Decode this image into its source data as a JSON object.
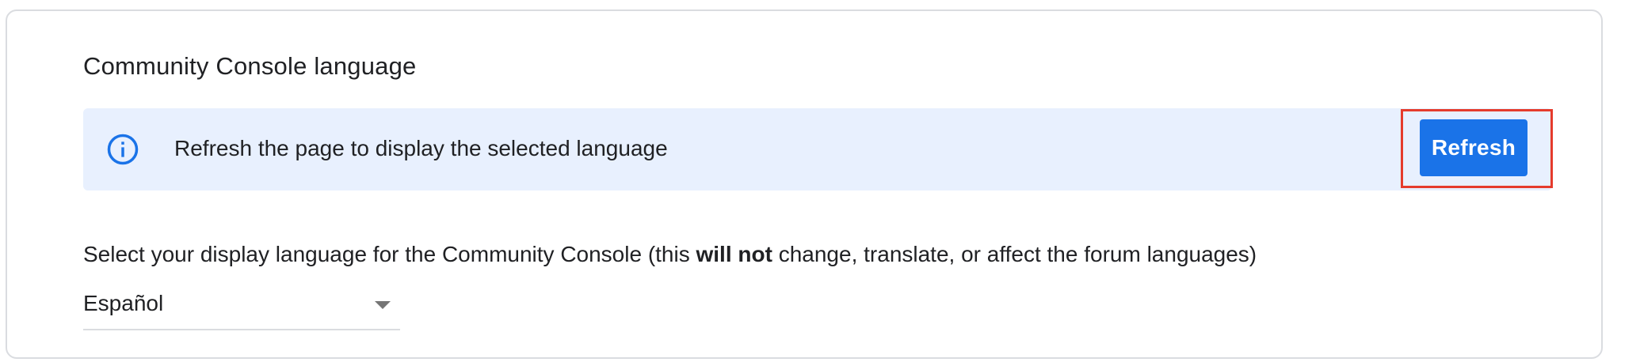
{
  "section": {
    "title": "Community Console language"
  },
  "banner": {
    "icon": "info-icon",
    "message": "Refresh the page to display the selected language",
    "button_label": "Refresh"
  },
  "description": {
    "prefix": "Select your display language for the Community Console (this ",
    "emphasis": "will not",
    "suffix": " change, translate, or affect the forum languages)"
  },
  "language_select": {
    "selected": "Español",
    "icon": "triangle-down-icon"
  },
  "colors": {
    "accent": "#1a73e8",
    "banner_bg": "#e8f0fe",
    "highlight": "#e53b2c",
    "text": "#202124",
    "border": "#dadce0"
  }
}
